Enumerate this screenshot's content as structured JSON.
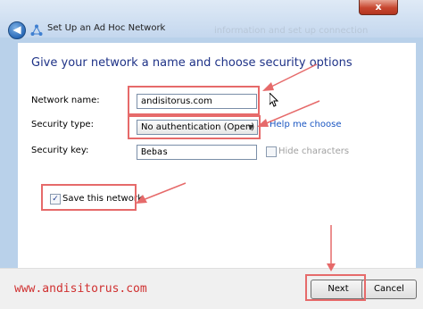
{
  "window": {
    "title": "Set Up an Ad Hoc Network",
    "background_text": "information and set up connection",
    "close_glyph": "x",
    "back_glyph": "◀"
  },
  "heading": "Give your network a name and choose security options",
  "form": {
    "network_name_label": "Network name:",
    "network_name_value": "andisitorus.com",
    "security_type_label": "Security type:",
    "security_type_value": "No authentication (Open)",
    "help_link": "Help me choose",
    "security_key_label": "Security key:",
    "security_key_value": "Bebas",
    "hide_characters_label": "Hide characters",
    "hide_characters_checked": false,
    "save_network_label": "Save this network",
    "save_network_checked": true,
    "check_glyph": "✓"
  },
  "footer": {
    "watermark": "www.andisitorus.com",
    "next_label": "Next",
    "cancel_label": "Cancel"
  },
  "colors": {
    "heading": "#1e3287",
    "annotation": "#e66a6a",
    "link": "#1a56c2"
  },
  "icons": [
    "close-icon",
    "back-arrow-icon",
    "network-icon",
    "dropdown-arrow-icon",
    "cursor-icon"
  ]
}
